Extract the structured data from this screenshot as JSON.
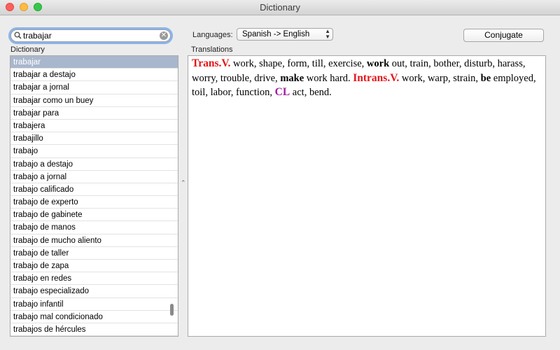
{
  "window": {
    "title": "Dictionary"
  },
  "search": {
    "value": "trabajar"
  },
  "labels": {
    "dictionary": "Dictionary",
    "translations": "Translations",
    "languages": "Languages:"
  },
  "languages": {
    "selected": "Spanish -> English"
  },
  "buttons": {
    "conjugate": "Conjugate"
  },
  "dictionary_list": {
    "selected_index": 0,
    "items": [
      "trabajar",
      "trabajar a destajo",
      "trabajar a jornal",
      "trabajar como un buey",
      "trabajar para",
      "trabajera",
      "trabajillo",
      "trabajo",
      "trabajo a destajo",
      "trabajo a jornal",
      "trabajo calificado",
      "trabajo de experto",
      "trabajo de gabinete",
      "trabajo de manos",
      "trabajo de mucho aliento",
      "trabajo de taller",
      "trabajo de zapa",
      "trabajo en redes",
      "trabajo especializado",
      "trabajo infantil",
      "trabajo mal condicionado",
      "trabajos de hércules"
    ]
  },
  "translation": {
    "segments": [
      {
        "text": "Trans.V.",
        "style": "red"
      },
      {
        "text": " work, shape, form, till, exercise, ",
        "style": "normal"
      },
      {
        "text": "work",
        "style": "bold"
      },
      {
        "text": " out, train, bother, disturb, harass, worry, trouble, drive, ",
        "style": "normal"
      },
      {
        "text": "make",
        "style": "bold"
      },
      {
        "text": " work hard. ",
        "style": "normal"
      },
      {
        "text": "Intrans.V.",
        "style": "red"
      },
      {
        "text": " work, warp, strain, ",
        "style": "normal"
      },
      {
        "text": "be",
        "style": "bold"
      },
      {
        "text": " employed, toil, labor, function, ",
        "style": "normal"
      },
      {
        "text": "CL",
        "style": "purple"
      },
      {
        "text": " act, bend.",
        "style": "normal"
      }
    ]
  },
  "colors": {
    "selection": "#a9b7cd",
    "part_of_speech": "#e3161a",
    "classifier": "#a11ca5",
    "focus_ring": "#8cb4e8"
  }
}
